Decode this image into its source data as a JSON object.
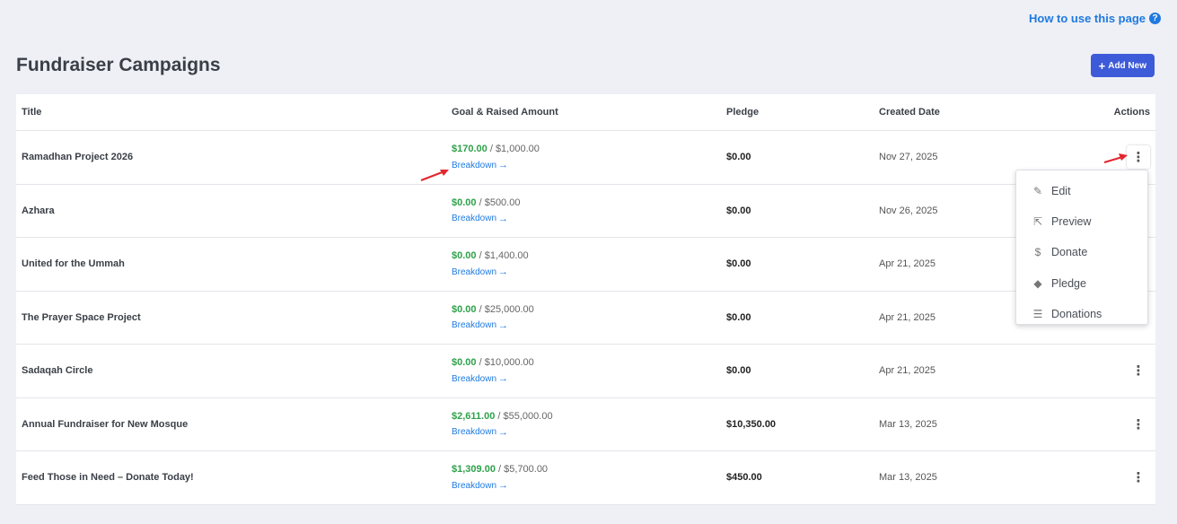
{
  "help": {
    "label": "How to use this page",
    "icon": "question-circle-icon"
  },
  "page": {
    "title": "Fundraiser Campaigns",
    "add_label": "Add New"
  },
  "table": {
    "headers": {
      "title": "Title",
      "goal": "Goal & Raised Amount",
      "pledge": "Pledge",
      "created": "Created Date",
      "actions": "Actions"
    },
    "breakdown_label": "Breakdown",
    "rows": [
      {
        "title": "Ramadhan Project 2026",
        "raised": "$170.00",
        "goal": "/ $1,000.00",
        "pledge": "$0.00",
        "created": "Nov 27, 2025"
      },
      {
        "title": "Azhara",
        "raised": "$0.00",
        "goal": "/ $500.00",
        "pledge": "$0.00",
        "created": "Nov 26, 2025"
      },
      {
        "title": "United for the Ummah",
        "raised": "$0.00",
        "goal": "/ $1,400.00",
        "pledge": "$0.00",
        "created": "Apr 21, 2025"
      },
      {
        "title": "The Prayer Space Project",
        "raised": "$0.00",
        "goal": "/ $25,000.00",
        "pledge": "$0.00",
        "created": "Apr 21, 2025"
      },
      {
        "title": "Sadaqah Circle",
        "raised": "$0.00",
        "goal": "/ $10,000.00",
        "pledge": "$0.00",
        "created": "Apr 21, 2025"
      },
      {
        "title": "Annual Fundraiser for New Mosque",
        "raised": "$2,611.00",
        "goal": "/ $55,000.00",
        "pledge": "$10,350.00",
        "created": "Mar 13, 2025"
      },
      {
        "title": "Feed Those in Need – Donate Today!",
        "raised": "$1,309.00",
        "goal": "/ $5,700.00",
        "pledge": "$450.00",
        "created": "Mar 13, 2025"
      }
    ]
  },
  "actions_menu": {
    "items": [
      {
        "label": "Edit",
        "icon": "edit-icon"
      },
      {
        "label": "Preview",
        "icon": "external-link-icon"
      },
      {
        "label": "Donate",
        "icon": "donate-hand-icon"
      },
      {
        "label": "Pledge",
        "icon": "handshake-icon"
      },
      {
        "label": "Donations",
        "icon": "list-icon"
      }
    ]
  },
  "colors": {
    "accent": "#3d5bd9",
    "link": "#1f7ae0",
    "raised": "#2ea14a",
    "annotation": "#e3262f"
  }
}
